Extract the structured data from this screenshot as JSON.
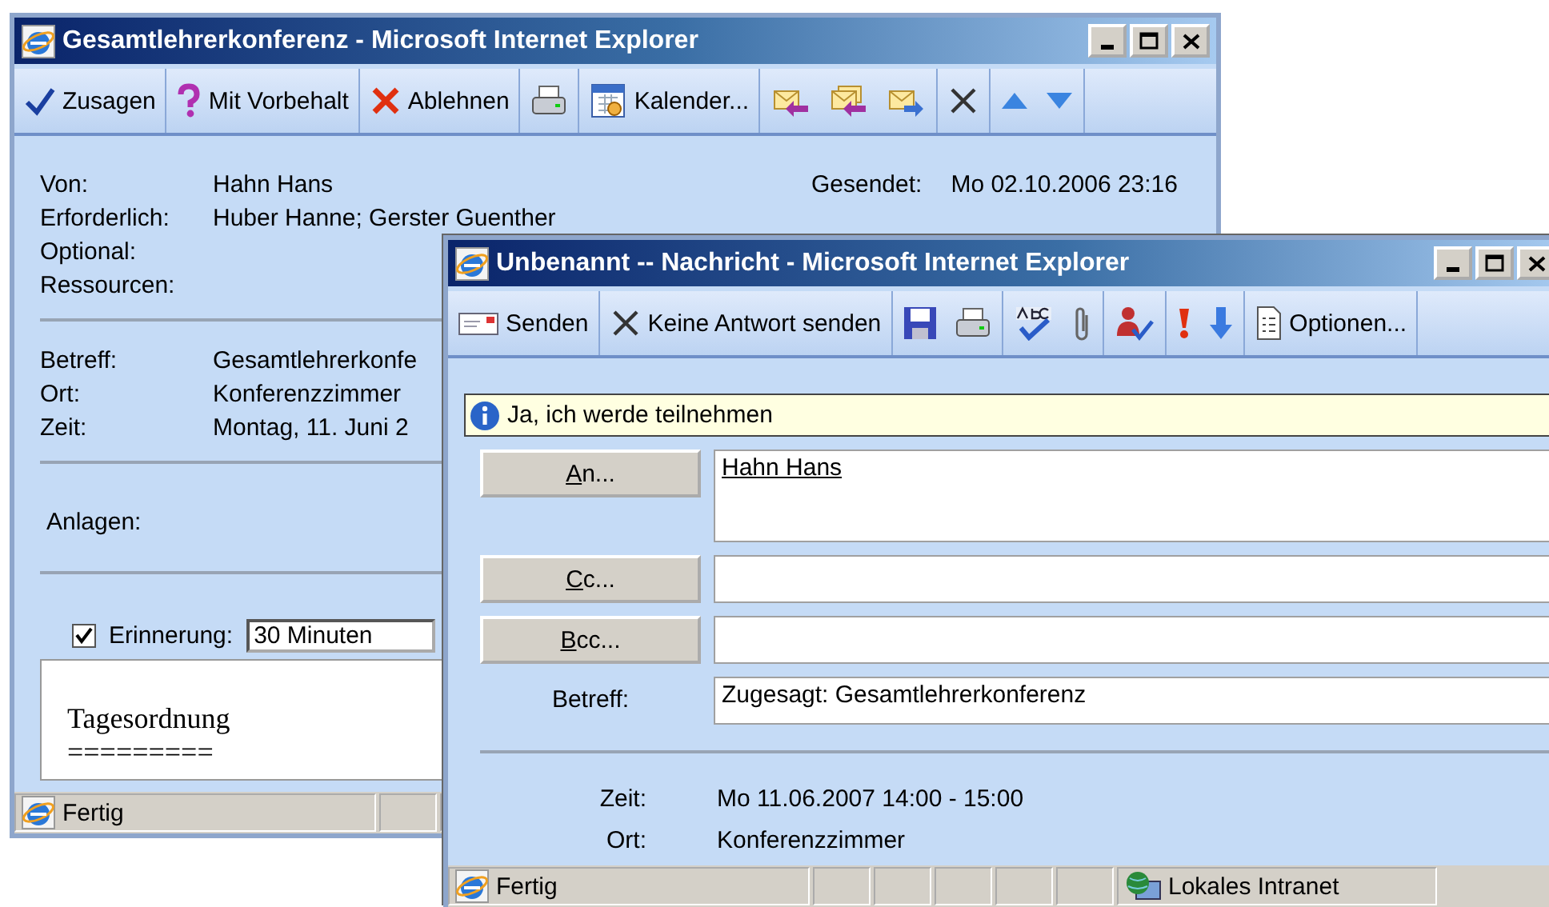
{
  "invitation_window": {
    "title": "Gesamtlehrerkonferenz - Microsoft Internet Explorer",
    "toolbar": [
      [
        {
          "kind": "labeled",
          "label": "Zusagen"
        }
      ],
      [
        {
          "kind": "labeled",
          "label": "Mit Vorbehalt"
        }
      ],
      [
        {
          "kind": "labeled",
          "label": "Ablehnen"
        }
      ],
      [
        {
          "kind": "icon"
        }
      ],
      [
        {
          "kind": "labeled",
          "label": "Kalender..."
        }
      ],
      [
        {
          "kind": "icon"
        },
        {
          "kind": "icon"
        },
        {
          "kind": "icon"
        }
      ],
      [
        {
          "kind": "icon"
        }
      ],
      [
        {
          "kind": "icon"
        },
        {
          "kind": "icon"
        }
      ]
    ],
    "header_fields": [
      {
        "label": "Von:",
        "value": "Hahn Hans"
      },
      {
        "label": "Erforderlich:",
        "value": "Huber Hanne; Gerster Guenther"
      },
      {
        "label": "Optional:"
      },
      {
        "label": "Ressourcen:"
      }
    ],
    "sent": {
      "label": "Gesendet:",
      "value": "Mo 02.10.2006 23:16"
    },
    "details": [
      {
        "label": "Betreff:",
        "value": "Gesamtlehrerkonfe"
      },
      {
        "label": "Ort:",
        "value": "Konferenzzimmer"
      },
      {
        "label": "Zeit:",
        "value": "Montag, 11. Juni 2"
      }
    ],
    "attachments_label": "Anlagen:",
    "reminder": {
      "checked": true,
      "label": "Erinnerung:",
      "value": "30 Minuten"
    },
    "body": [
      "Tagesordnung",
      "========="
    ],
    "status": "Fertig"
  },
  "reply_window": {
    "title": "Unbenannt -- Nachricht - Microsoft Internet Explorer",
    "toolbar": [
      [
        {
          "kind": "labeled",
          "label": "Senden"
        }
      ],
      [
        {
          "kind": "labeled",
          "label": "Keine Antwort senden"
        }
      ],
      [
        {
          "kind": "icon"
        },
        {
          "kind": "icon"
        }
      ],
      [
        {
          "kind": "icon"
        },
        {
          "kind": "icon"
        }
      ],
      [
        {
          "kind": "icon"
        }
      ],
      [
        {
          "kind": "icon"
        },
        {
          "kind": "icon"
        }
      ],
      [
        {
          "kind": "labeled",
          "label": "Optionen..."
        }
      ]
    ],
    "info": "Ja, ich werde teilnehmen",
    "address_fields": [
      {
        "kind": "button",
        "label": "An...",
        "value": "Hahn Hans",
        "resolved": true
      },
      {
        "kind": "button",
        "label": "Cc..."
      },
      {
        "kind": "button",
        "label": "Bcc..."
      },
      {
        "kind": "label",
        "label": "Betreff:",
        "value": "Zugesagt: Gesamtlehrerkonferenz",
        "resolved": false
      }
    ],
    "meeting_info": [
      {
        "label": "Zeit:",
        "value": "Mo 11.06.2007 14:00 - 15:00"
      },
      {
        "label": "Ort:",
        "value": "Konferenzzimmer"
      }
    ],
    "status": "Fertig",
    "zone": "Lokales Intranet"
  }
}
